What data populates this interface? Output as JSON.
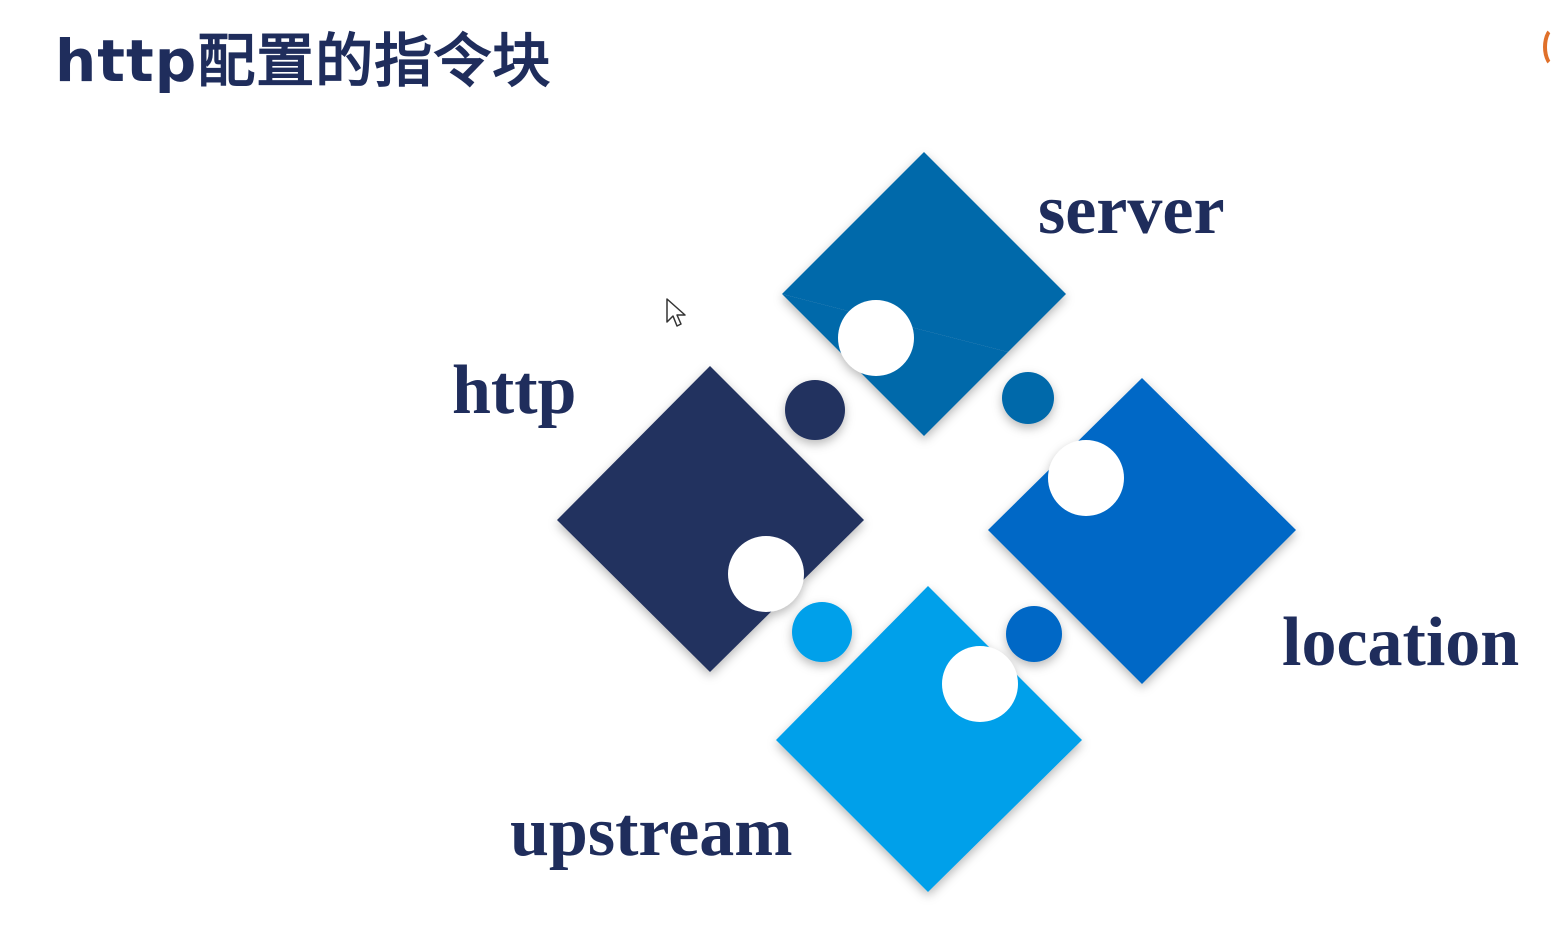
{
  "slide": {
    "title": "http配置的指令块"
  },
  "pieces": [
    {
      "id": "server",
      "label": "server",
      "color": "#0469aa"
    },
    {
      "id": "http",
      "label": "http",
      "color": "#21305e"
    },
    {
      "id": "location",
      "label": "location",
      "color": "#0068c6"
    },
    {
      "id": "upstream",
      "label": "upstream",
      "color": "#00a0ea"
    }
  ],
  "colors": {
    "text": "#1f2d5c",
    "background": "#ffffff",
    "accent": "#e0702a"
  },
  "icons": {
    "cursor": "mouse-pointer-icon",
    "accent": "orange-arc-icon"
  }
}
